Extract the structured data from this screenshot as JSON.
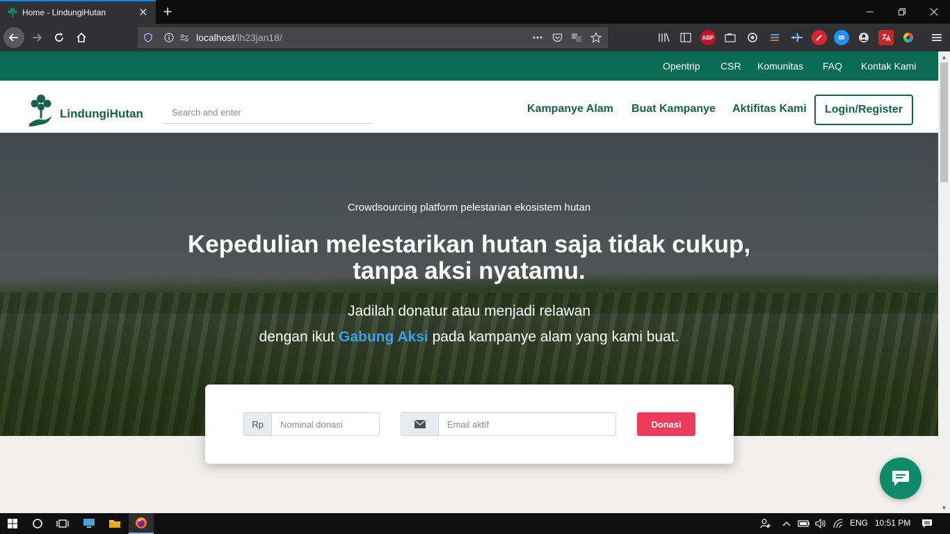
{
  "browser": {
    "tab_title": "Home - LindungiHutan",
    "url_host": "localhost",
    "url_path": "/lh23jan18/",
    "close_tab_glyph": "✕",
    "new_tab_glyph": "+",
    "icons": [
      "back-icon",
      "forward-icon",
      "reload-icon",
      "home-icon",
      "shield-icon",
      "info-icon",
      "more-icon",
      "pocket-icon",
      "translate-icon",
      "star-icon",
      "library-icon",
      "sidebar-icon",
      "adblock-icon",
      "extensions"
    ],
    "extensions": {
      "abp": "ABP"
    }
  },
  "topbar": {
    "links": [
      "Opentrip",
      "CSR",
      "Komunitas",
      "FAQ",
      "Kontak Kami"
    ]
  },
  "header": {
    "brand": "LindungiHutan",
    "search_placeholder": "Search and enter",
    "nav": [
      "Kampanye Alam",
      "Buat Kampanye",
      "Aktifitas Kami"
    ],
    "login_label": "Login/Register"
  },
  "hero": {
    "eyebrow": "Crowdsourcing platform pelestarian ekosistem hutan",
    "headline_line1": "Kepedulian melestarikan hutan saja tidak cukup,",
    "headline_line2": "tanpa aksi nyatamu.",
    "sub_line1": "Jadilah donatur atau menjadi relawan",
    "sub_line2_pre": "dengan ikut ",
    "sub_line2_accent": "Gabung Aksi",
    "sub_line2_post": " pada kampanye alam yang kami buat."
  },
  "donation": {
    "currency_prefix": "Rp",
    "amount_placeholder": "Nominal donasi",
    "email_placeholder": "Email aktif",
    "submit_label": "Donasi"
  },
  "taskbar": {
    "language": "ENG",
    "time": "10:51 PM"
  },
  "colors": {
    "brand_green": "#0a6b54",
    "text_green": "#14614d",
    "accent_blue": "#3ba1e6",
    "donate_red": "#ee3b59",
    "chat_green": "#0d8a6a"
  }
}
